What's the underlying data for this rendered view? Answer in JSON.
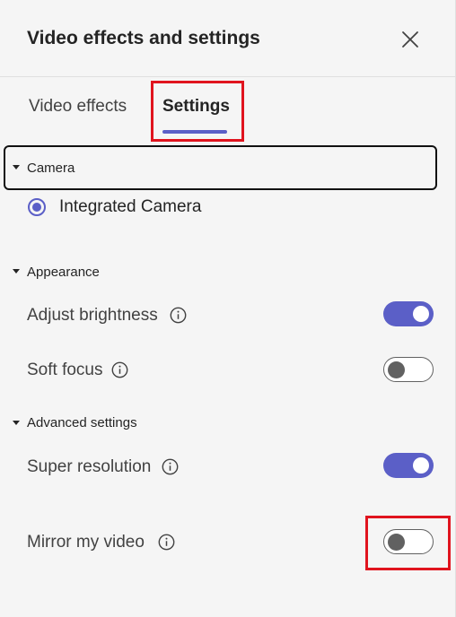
{
  "header": {
    "title": "Video effects and settings"
  },
  "tabs": [
    {
      "label": "Video effects",
      "selected": false
    },
    {
      "label": "Settings",
      "selected": true
    }
  ],
  "camera": {
    "section_label": "Camera",
    "options": [
      {
        "label": "Integrated Camera",
        "selected": true
      }
    ]
  },
  "appearance": {
    "section_label": "Appearance",
    "settings": [
      {
        "label": "Adjust brightness",
        "enabled": true
      },
      {
        "label": "Soft focus",
        "enabled": false
      }
    ]
  },
  "advanced": {
    "section_label": "Advanced settings",
    "settings": [
      {
        "label": "Super resolution",
        "enabled": true
      },
      {
        "label": "Mirror my video",
        "enabled": false
      }
    ]
  },
  "colors": {
    "accent": "#5b5fc7",
    "highlight": "#e0141e",
    "background": "#f5f5f5"
  },
  "icons": [
    "close-icon",
    "caret-down-icon",
    "info-icon",
    "radio-icon",
    "toggle-icon"
  ]
}
